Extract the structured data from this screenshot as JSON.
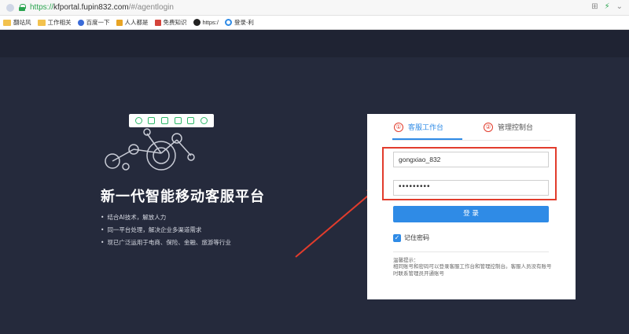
{
  "browser": {
    "url_proto": "https://",
    "url_host": "kfportal.fupin832.com",
    "url_path": "/#/agentlogin",
    "bookmarks": [
      {
        "label": "翻站风",
        "icon": "folder-icon"
      },
      {
        "label": "工作相关",
        "icon": "folder-icon"
      },
      {
        "label": "百度一下",
        "icon": "paw-icon"
      },
      {
        "label": "人人都是",
        "icon": "people-icon"
      },
      {
        "label": "免费知识",
        "icon": "red-icon"
      },
      {
        "label": "https:/",
        "icon": "w-icon"
      },
      {
        "label": "登录-利",
        "icon": "circle-icon"
      }
    ]
  },
  "hero": {
    "title": "新一代智能移动客服平台",
    "bullets": [
      "结合AI技术，解放人力",
      "同一平台处理，解决企业多渠道需求",
      "现已广泛运用于电商、保险、金融、旅游等行业"
    ]
  },
  "login": {
    "tab1_number": "①",
    "tab1_label": "客服工作台",
    "tab2_number": "②",
    "tab2_label": "管理控制台",
    "username_value": "gongxiao_832",
    "password_value": "•••••••••",
    "submit_label": "登 录",
    "remember_label": "记住密码",
    "tip_title": "温馨提示：",
    "tip_body": "相同账号和密码可以登录客服工作台和管理控制台。客服人员没有账号时联系管理员开通账号"
  },
  "colors": {
    "accent": "#2f8be6",
    "annotation_red": "#e23c2c",
    "background": "#252a3c"
  }
}
